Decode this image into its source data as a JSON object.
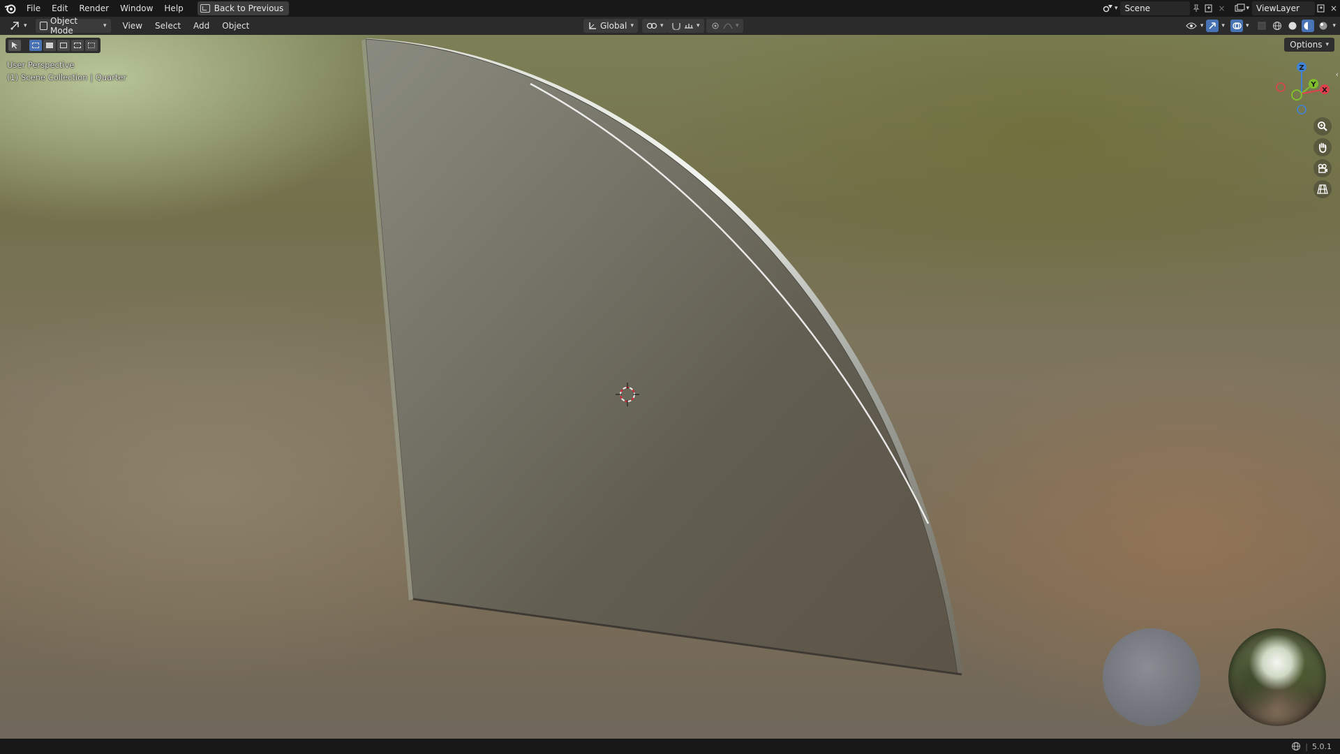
{
  "menu": {
    "items": [
      "File",
      "Edit",
      "Render",
      "Window",
      "Help"
    ],
    "back_button_label": "Back to Previous"
  },
  "scene": {
    "scene_name": "Scene",
    "view_layer_name": "ViewLayer"
  },
  "header": {
    "mode_label": "Object Mode",
    "menus": [
      "View",
      "Select",
      "Add",
      "Object"
    ],
    "transform_orientation": "Global",
    "options_label": "Options"
  },
  "viewport": {
    "view_name": "User Perspective",
    "collection_info": "(1) Scene Collection | Quarter",
    "gizmo_axes": {
      "z": "Z",
      "y": "Y",
      "x": "X"
    }
  },
  "status": {
    "version": "5.0.1"
  },
  "colors": {
    "accent": "#4772b3",
    "axis_x": "#e0404e",
    "axis_y": "#7fbf2e",
    "axis_z": "#3f83d6"
  }
}
